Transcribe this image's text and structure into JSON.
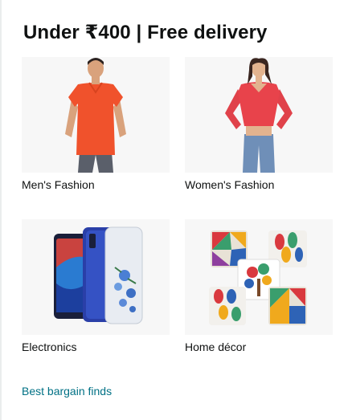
{
  "card": {
    "title": "Under ₹400 | Free delivery",
    "tiles": [
      {
        "label": "Men's Fashion",
        "image": "man-orange-tshirt"
      },
      {
        "label": "Women's Fashion",
        "image": "woman-red-top"
      },
      {
        "label": "Electronics",
        "image": "phone-cases"
      },
      {
        "label": "Home décor",
        "image": "cushion-covers"
      }
    ],
    "footer_link": "Best bargain finds"
  },
  "colors": {
    "title": "#0f1111",
    "link": "#007185",
    "tile_bg": "#f7f7f7"
  }
}
